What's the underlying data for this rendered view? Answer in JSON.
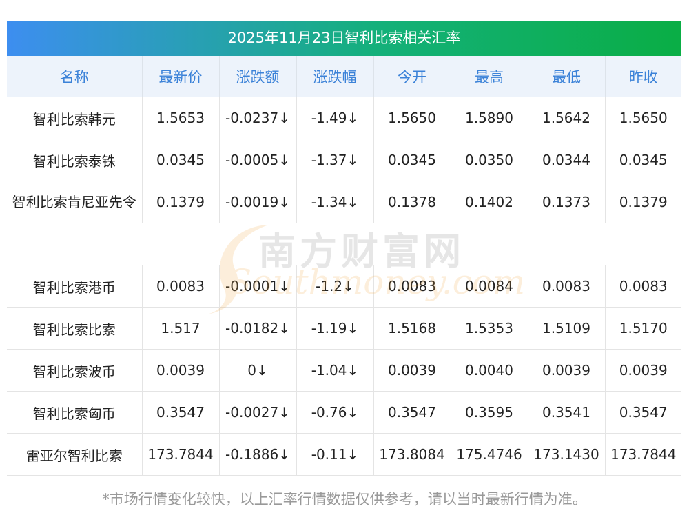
{
  "title": "2025年11月23日智利比索相关汇率",
  "headers": [
    "名称",
    "最新价",
    "涨跌额",
    "涨跌幅",
    "今开",
    "最高",
    "最低",
    "昨收"
  ],
  "rows": [
    {
      "name": "智利比索韩元",
      "latest": "1.5653",
      "change": "-0.0237↓",
      "pct": "-1.49↓",
      "open": "1.5650",
      "high": "1.5890",
      "low": "1.5642",
      "prev": "1.5650"
    },
    {
      "name": "智利比索泰铢",
      "latest": "0.0345",
      "change": "-0.0005↓",
      "pct": "-1.37↓",
      "open": "0.0345",
      "high": "0.0350",
      "low": "0.0344",
      "prev": "0.0345"
    },
    {
      "name": "智利比索肯尼亚先令",
      "latest": "0.1379",
      "change": "-0.0019↓",
      "pct": "-1.34↓",
      "open": "0.1378",
      "high": "0.1402",
      "low": "0.1373",
      "prev": "0.1379"
    },
    {
      "name": "智利比索港币",
      "latest": "0.0083",
      "change": "-0.0001↓",
      "pct": "-1.2↓",
      "open": "0.0083",
      "high": "0.0084",
      "low": "0.0083",
      "prev": "0.0083"
    },
    {
      "name": "智利比索比索",
      "latest": "1.517",
      "change": "-0.0182↓",
      "pct": "-1.19↓",
      "open": "1.5168",
      "high": "1.5353",
      "low": "1.5109",
      "prev": "1.5170"
    },
    {
      "name": "智利比索波币",
      "latest": "0.0039",
      "change": "0↓",
      "pct": "-1.04↓",
      "open": "0.0039",
      "high": "0.0040",
      "low": "0.0039",
      "prev": "0.0039"
    },
    {
      "name": "智利比索匈币",
      "latest": "0.3547",
      "change": "-0.0027↓",
      "pct": "-0.76↓",
      "open": "0.3547",
      "high": "0.3595",
      "low": "0.3541",
      "prev": "0.3547"
    },
    {
      "name": "雷亚尔智利比索",
      "latest": "173.7844",
      "change": "-0.1886↓",
      "pct": "-0.11↓",
      "open": "173.8084",
      "high": "175.4746",
      "low": "173.1430",
      "prev": "173.7844"
    }
  ],
  "watermark": {
    "cn": "南方财富网",
    "en": "Southmoney.com"
  },
  "footer": "*市场行情变化较快，以上汇率行情数据仅供参考，请以当时最新行情为准。",
  "colors": {
    "header_text": "#3b82d8",
    "up_down_green": "#1a8a1a",
    "title_gradient_start": "#3d8ef0",
    "title_gradient_end": "#0aae45"
  }
}
